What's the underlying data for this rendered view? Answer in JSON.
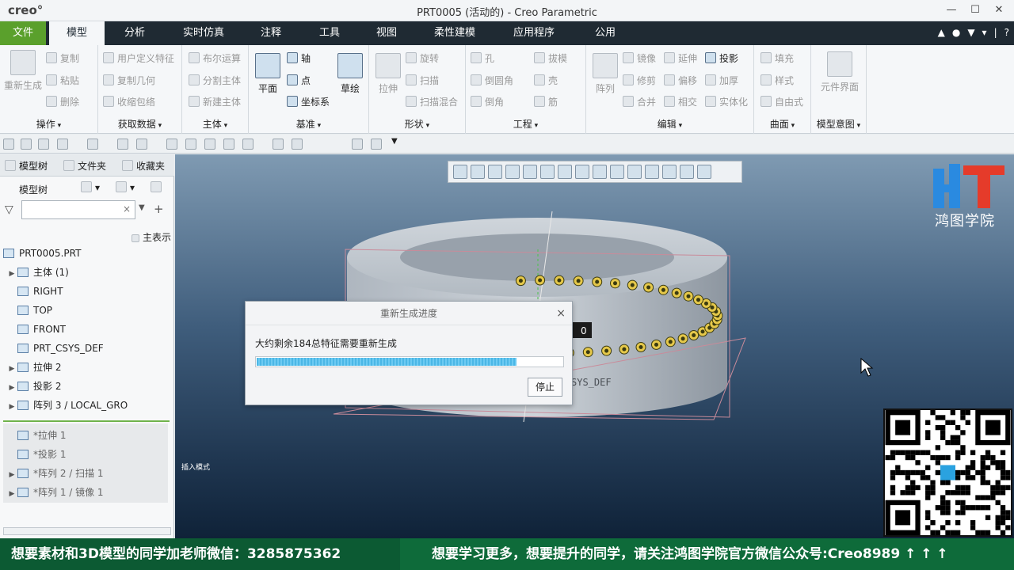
{
  "window": {
    "logo": "creo°",
    "title": "PRT0005 (活动的) - Creo Parametric",
    "minimize": "—",
    "maximize": "☐",
    "close": "✕"
  },
  "tabs": {
    "file": "文件",
    "items": [
      "模型",
      "分析",
      "实时仿真",
      "注释",
      "工具",
      "视图",
      "柔性建模",
      "应用程序",
      "公用"
    ],
    "active": "模型"
  },
  "ribbon": {
    "ops": {
      "label": "操作",
      "regen": "重新生成",
      "copy": "复制",
      "paste": "粘贴",
      "delete": "删除"
    },
    "getdata": {
      "label": "获取数据",
      "udf": "用户定义特征",
      "copygeom": "复制几何",
      "shrinkwrap": "收缩包络"
    },
    "body": {
      "label": "主体",
      "boolean": "布尔运算",
      "split": "分割主体",
      "newbody": "新建主体"
    },
    "datum": {
      "label": "基准",
      "plane": "平面",
      "axis": "轴",
      "point": "点",
      "csys": "坐标系",
      "sketch": "草绘"
    },
    "shapes": {
      "label": "形状",
      "extrude": "拉伸",
      "revolve": "旋转",
      "sweep": "扫描",
      "sweptblend": "扫描混合"
    },
    "engineering": {
      "label": "工程",
      "hole": "孔",
      "round": "倒圆角",
      "chamfer": "倒角",
      "draft": "拔模",
      "shell": "壳",
      "rib": "筋"
    },
    "editing": {
      "label": "编辑",
      "pattern": "阵列",
      "mirror": "镜像",
      "trim": "修剪",
      "merge": "合并",
      "extend": "延伸",
      "offset": "偏移",
      "intersect": "相交",
      "project": "投影",
      "thicken": "加厚",
      "solidify": "实体化"
    },
    "surfaces": {
      "label": "曲面",
      "fill": "填充",
      "style": "样式",
      "freestyle": "自由式"
    },
    "intent": {
      "label": "模型意图",
      "component": "元件界面"
    }
  },
  "leftpanel": {
    "tabs": [
      "模型树",
      "文件夹",
      "收藏夹"
    ],
    "tree_header": "模型树",
    "filter_placeholder": "",
    "main_table": "主表示",
    "items": [
      {
        "label": "PRT0005.PRT",
        "expand": ""
      },
      {
        "label": "主体 (1)",
        "expand": "▶"
      },
      {
        "label": "RIGHT",
        "expand": ""
      },
      {
        "label": "TOP",
        "expand": ""
      },
      {
        "label": "FRONT",
        "expand": ""
      },
      {
        "label": "PRT_CSYS_DEF",
        "expand": ""
      },
      {
        "label": "拉伸 2",
        "expand": "▶"
      },
      {
        "label": "投影 2",
        "expand": "▶"
      },
      {
        "label": "阵列 3 / LOCAL_GRO",
        "expand": "▶"
      }
    ],
    "suppressed": [
      {
        "label": "*拉伸 1",
        "expand": ""
      },
      {
        "label": "*投影 1",
        "expand": ""
      },
      {
        "label": "*阵列 2 / 扫描 1",
        "expand": "▶"
      },
      {
        "label": "*阵列 1 / 镜像 1",
        "expand": "▶"
      }
    ]
  },
  "viewport": {
    "insert_label": "插入模式",
    "csys_label": "SYS_DEF",
    "dim_label": "0"
  },
  "dialog": {
    "title": "重新生成进度",
    "close": "×",
    "message": "大约剩余184总特征需要重新生成",
    "progress": 0.85,
    "stop": "停止"
  },
  "watermark": {
    "text": "鸿图学院"
  },
  "banner": {
    "left": "想要素材和3D模型的同学加老师微信：3285875362",
    "right": "想要学习更多，想要提升的同学，请关注鸿图学院官方微信公众号:Creo8989 ↑ ↑ ↑"
  },
  "colors": {
    "file_tab": "#5aa02c",
    "tab_bar": "#1f2a33",
    "progress": "#4bb7e6",
    "banner": "#0e6b3a"
  }
}
